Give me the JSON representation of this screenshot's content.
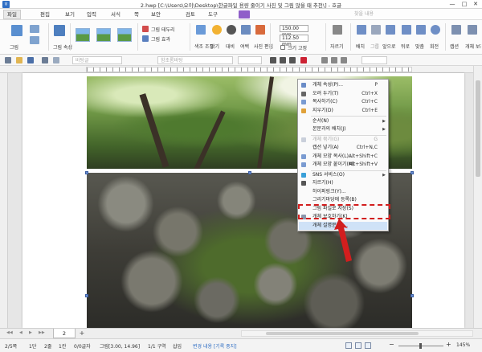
{
  "window": {
    "title": "2.hwp [C:\\Users\\오이\\Desktop\\한글파일 용량 줄이기 사진 및 그림 많을 때 추천\\] - 호글",
    "app_icon": "hwp-icon",
    "controls": [
      "—",
      "□",
      "✕"
    ]
  },
  "menubar": {
    "items": [
      "파일",
      "편집",
      "보기",
      "입력",
      "서식",
      "쪽",
      "보안",
      "검토",
      "도구"
    ],
    "search_placeholder": "찾을 내용"
  },
  "ribbon": {
    "groups": [
      {
        "label": "그림"
      },
      {
        "label": "그림 속성"
      },
      {
        "label": "그림 테두리"
      },
      {
        "label": "그림 효과"
      },
      {
        "label": "색조 조정"
      },
      {
        "label": "밝기"
      },
      {
        "label": "대비"
      },
      {
        "label": "여백"
      },
      {
        "label": "사진 편집"
      },
      {
        "label": "자르기"
      },
      {
        "label": "배치"
      },
      {
        "label": "그룹"
      },
      {
        "label": "앞으로"
      },
      {
        "label": "뒤로"
      },
      {
        "label": "맞춤"
      },
      {
        "label": "회전"
      },
      {
        "label": "캡션"
      },
      {
        "label": "개체 보호"
      }
    ],
    "width_value": "150.00 mm",
    "height_value": "112.50 mm",
    "size_lock_label": "크기 고정"
  },
  "toolbar2": {
    "style_field": "바탕글",
    "font_field": "함초롬바탕"
  },
  "context_menu": {
    "items": [
      {
        "label": "개체 속성(P)...",
        "shortcut": "P",
        "icon": "properties-icon",
        "arrow": false,
        "disabled": false
      },
      {
        "label": "오려 두기(T)",
        "shortcut": "Ctrl+X",
        "icon": "cut-icon",
        "arrow": false,
        "disabled": false
      },
      {
        "label": "복사하기(C)",
        "shortcut": "Ctrl+C",
        "icon": "copy-icon",
        "arrow": false,
        "disabled": false
      },
      {
        "label": "지우기(D)",
        "shortcut": "Ctrl+E",
        "icon": "delete-icon",
        "arrow": false,
        "disabled": false
      },
      {
        "label": "순서(N)",
        "shortcut": "",
        "icon": "",
        "arrow": true,
        "disabled": false
      },
      {
        "label": "본문과의 배치(J)",
        "shortcut": "",
        "icon": "",
        "arrow": true,
        "disabled": false
      },
      {
        "label": "개체 묶기(G)",
        "shortcut": "G",
        "icon": "group-icon",
        "arrow": false,
        "disabled": true
      },
      {
        "label": "캡션 넣기(A)",
        "shortcut": "Ctrl+N,C",
        "icon": "",
        "arrow": false,
        "disabled": false
      },
      {
        "label": "개체 모양 복사(L)...",
        "shortcut": "Alt+Shift+C",
        "icon": "shape-copy-icon",
        "arrow": false,
        "disabled": false
      },
      {
        "label": "개체 모양 붙이기(M)",
        "shortcut": "Alt+Shift+V",
        "icon": "shape-paste-icon",
        "arrow": false,
        "disabled": false
      },
      {
        "label": "SNS 서비스(O)",
        "shortcut": "",
        "icon": "sns-icon",
        "arrow": true,
        "disabled": false
      },
      {
        "label": "자르기(H)",
        "shortcut": "",
        "icon": "crop-icon",
        "arrow": false,
        "disabled": false
      },
      {
        "label": "하이퍼링크(Y)...",
        "shortcut": "",
        "icon": "",
        "arrow": false,
        "disabled": false
      },
      {
        "label": "그리기마당에 등록(B)",
        "shortcut": "",
        "icon": "",
        "arrow": false,
        "disabled": false
      },
      {
        "label": "그림 파일로 저장(S)",
        "shortcut": "",
        "icon": "",
        "arrow": false,
        "disabled": false
      },
      {
        "label": "개체 보호하기(K)",
        "shortcut": "",
        "icon": "protect-icon",
        "arrow": false,
        "disabled": false
      },
      {
        "label": "개체 설명문(X)...",
        "shortcut": "",
        "icon": "",
        "arrow": false,
        "disabled": false
      }
    ]
  },
  "tabs": {
    "active": "2",
    "add_label": "+"
  },
  "status": {
    "page": "2/5쪽",
    "section": "1단",
    "line": "2줄",
    "column": "1칸",
    "chars": "0/0글자",
    "object": "그림[3.00, 14.96]",
    "area": "1/1 구역",
    "insert_mode": "삽입",
    "track_changes": "변경 내용 [기록 중지]",
    "zoom": "145%"
  },
  "colors": {
    "accent": "#2f6ec4",
    "annotation_red": "#d21e1e",
    "menu_highlight": "#cfe2f7"
  }
}
